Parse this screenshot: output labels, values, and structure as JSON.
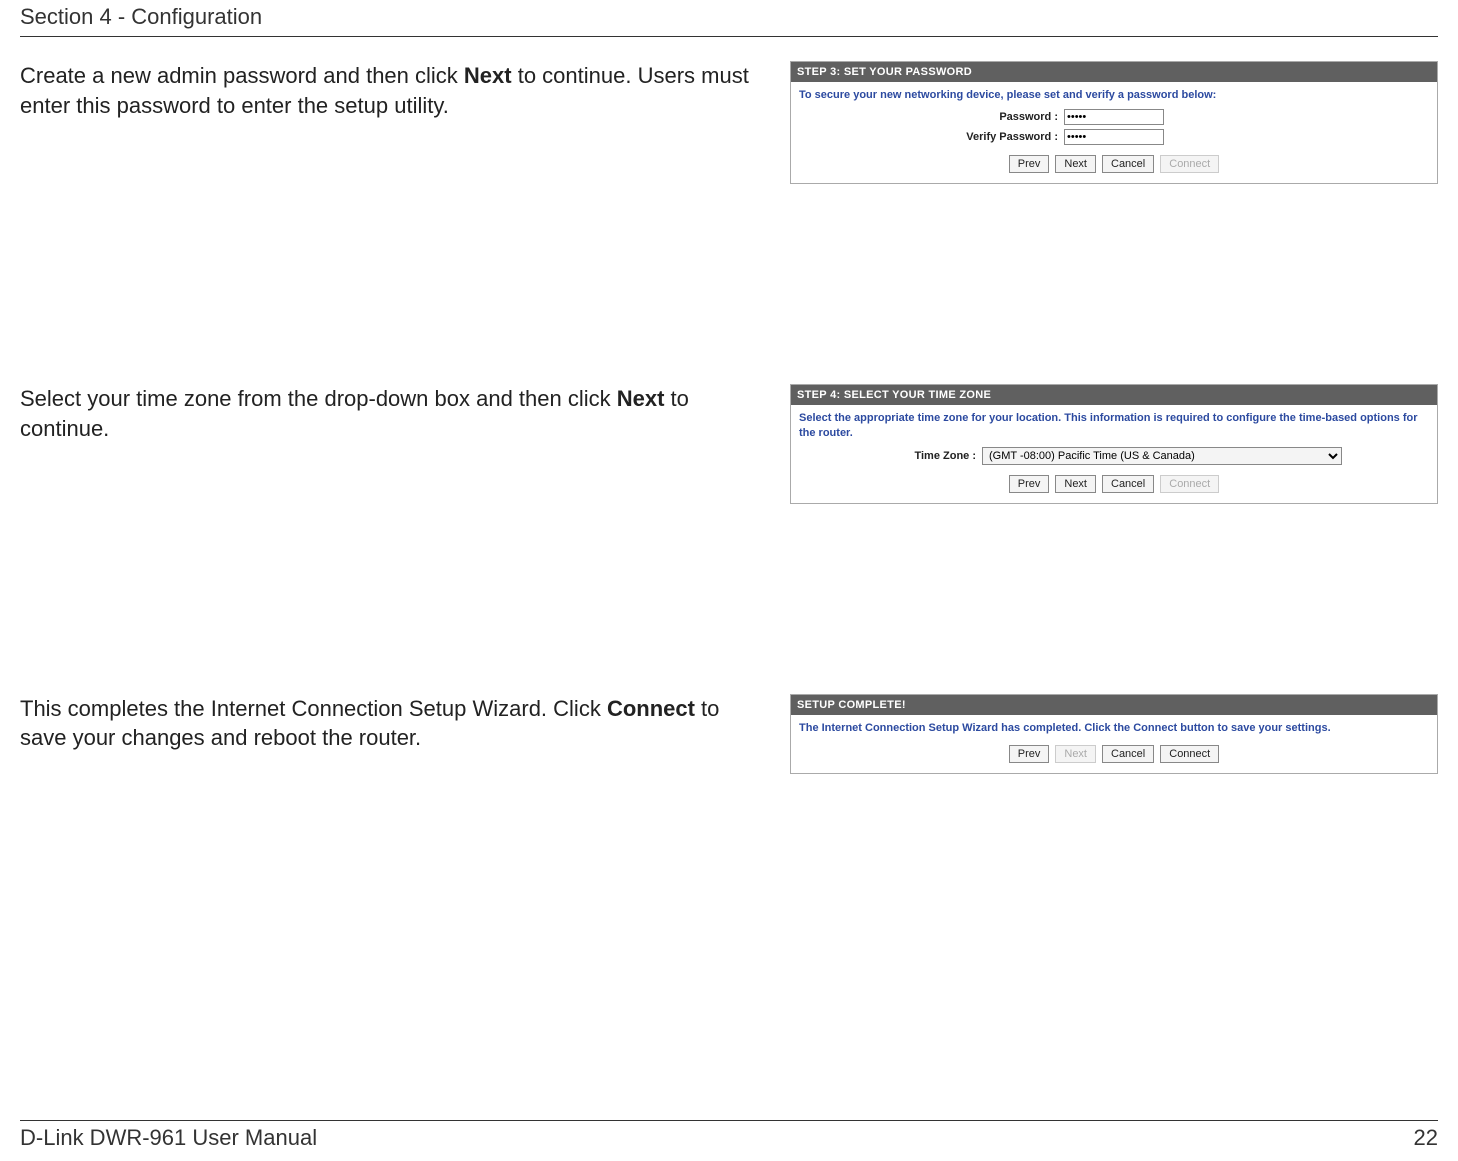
{
  "header": {
    "section": "Section 4 - Configuration"
  },
  "step3": {
    "instruction_pre": "Create a new admin password and then click ",
    "instruction_bold": "Next",
    "instruction_post": " to continue. Users must enter this password to enter the setup utility.",
    "panel_title": "STEP 3: SET YOUR PASSWORD",
    "help": "To secure your new networking device, please set and verify a password below:",
    "password_label": "Password :",
    "verify_label": "Verify Password :",
    "password_value": "•••••",
    "verify_value": "•••••",
    "buttons": {
      "prev": "Prev",
      "next": "Next",
      "cancel": "Cancel",
      "connect": "Connect"
    }
  },
  "step4": {
    "instruction_pre": "Select your time zone from the drop-down box and then click ",
    "instruction_bold": "Next",
    "instruction_post": " to continue.",
    "panel_title": "STEP 4: SELECT YOUR TIME ZONE",
    "help": "Select the appropriate time zone for your location. This information is required to configure the time-based options for the router.",
    "tz_label": "Time Zone :",
    "tz_value": "(GMT -08:00) Pacific Time (US & Canada)",
    "buttons": {
      "prev": "Prev",
      "next": "Next",
      "cancel": "Cancel",
      "connect": "Connect"
    }
  },
  "complete": {
    "instruction_pre": "This completes the Internet Connection Setup Wizard. Click ",
    "instruction_bold": "Connect",
    "instruction_post": " to save your changes and reboot the router.",
    "panel_title": "SETUP COMPLETE!",
    "help": "The Internet Connection Setup Wizard has completed. Click the Connect button to save your settings.",
    "buttons": {
      "prev": "Prev",
      "next": "Next",
      "cancel": "Cancel",
      "connect": "Connect"
    }
  },
  "footer": {
    "manual": "D-Link DWR-961 User Manual",
    "page": "22"
  }
}
